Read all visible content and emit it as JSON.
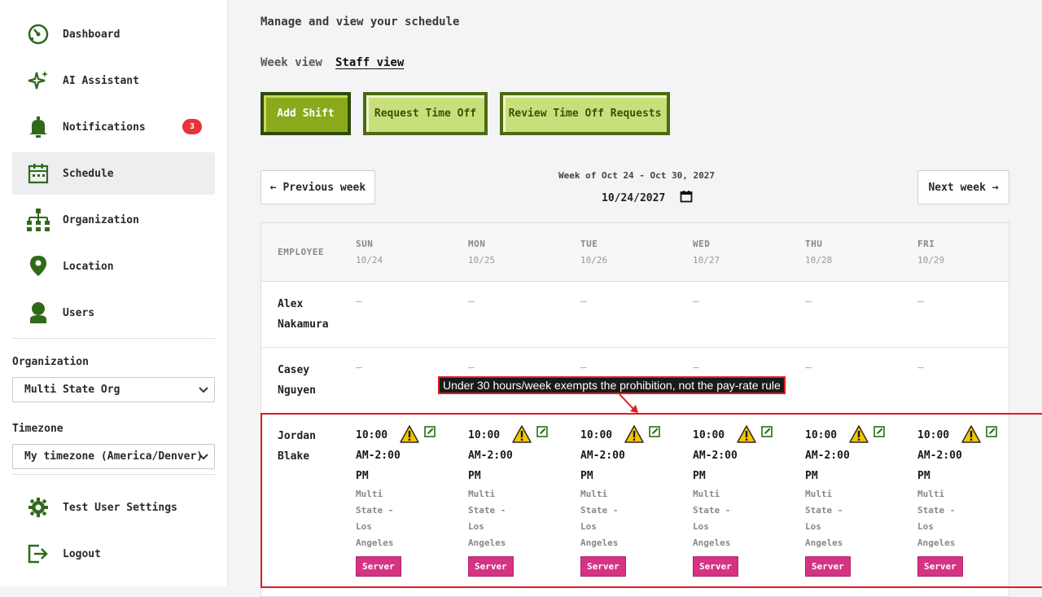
{
  "sidebar": {
    "items": [
      {
        "label": "Dashboard",
        "icon": "dashboard-icon"
      },
      {
        "label": "AI Assistant",
        "icon": "sparkle-icon"
      },
      {
        "label": "Notifications",
        "icon": "bell-icon",
        "badge": "3"
      },
      {
        "label": "Schedule",
        "icon": "calendar-icon",
        "active": true
      },
      {
        "label": "Organization",
        "icon": "org-chart-icon"
      },
      {
        "label": "Location",
        "icon": "location-pin-icon"
      },
      {
        "label": "Users",
        "icon": "user-icon"
      }
    ],
    "organization_label": "Organization",
    "organization_value": "Multi State Org",
    "timezone_label": "Timezone",
    "timezone_value": "My timezone (America/Denver)",
    "settings_label": "Test User Settings",
    "logout_label": "Logout"
  },
  "main": {
    "subtitle": "Manage and view your schedule",
    "tabs": [
      {
        "label": "Week view",
        "active": false
      },
      {
        "label": "Staff view",
        "active": true
      }
    ],
    "actions": {
      "add_shift": "Add Shift",
      "request_time_off": "Request Time Off",
      "review_time_off": "Review Time Off Requests"
    },
    "week_nav": {
      "previous": "← Previous week",
      "next": "Next week →",
      "range": "Week of Oct 24 - Oct 30, 2027",
      "date_value": "10/24/2027"
    },
    "table": {
      "employee_header": "EMPLOYEE",
      "days": [
        {
          "day": "SUN",
          "date": "10/24"
        },
        {
          "day": "MON",
          "date": "10/25"
        },
        {
          "day": "TUE",
          "date": "10/26"
        },
        {
          "day": "WED",
          "date": "10/27"
        },
        {
          "day": "THU",
          "date": "10/28"
        },
        {
          "day": "FRI",
          "date": "10/29"
        }
      ],
      "empty_cell": "–",
      "rows": [
        {
          "first": "Alex",
          "last": "Nakamura"
        },
        {
          "first": "Casey",
          "last": "Nguyen"
        },
        {
          "first": "Jordan",
          "last": "Blake"
        }
      ],
      "shift": {
        "time": "10:00 AM-2:00 PM",
        "location": "Multi State - Los Angeles",
        "role": "Server"
      }
    }
  },
  "annotation": {
    "text": "Under 30 hours/week exempts the prohibition, not the pay-rate rule"
  },
  "colors": {
    "primary_green": "#8aaa1c",
    "light_green": "#c8e07a",
    "dark_green": "#2e4a0a",
    "icon_green": "#2f6a1a",
    "badge_red": "#e8323c",
    "role_pink": "#d63384",
    "annotation_red": "#e11b22"
  }
}
